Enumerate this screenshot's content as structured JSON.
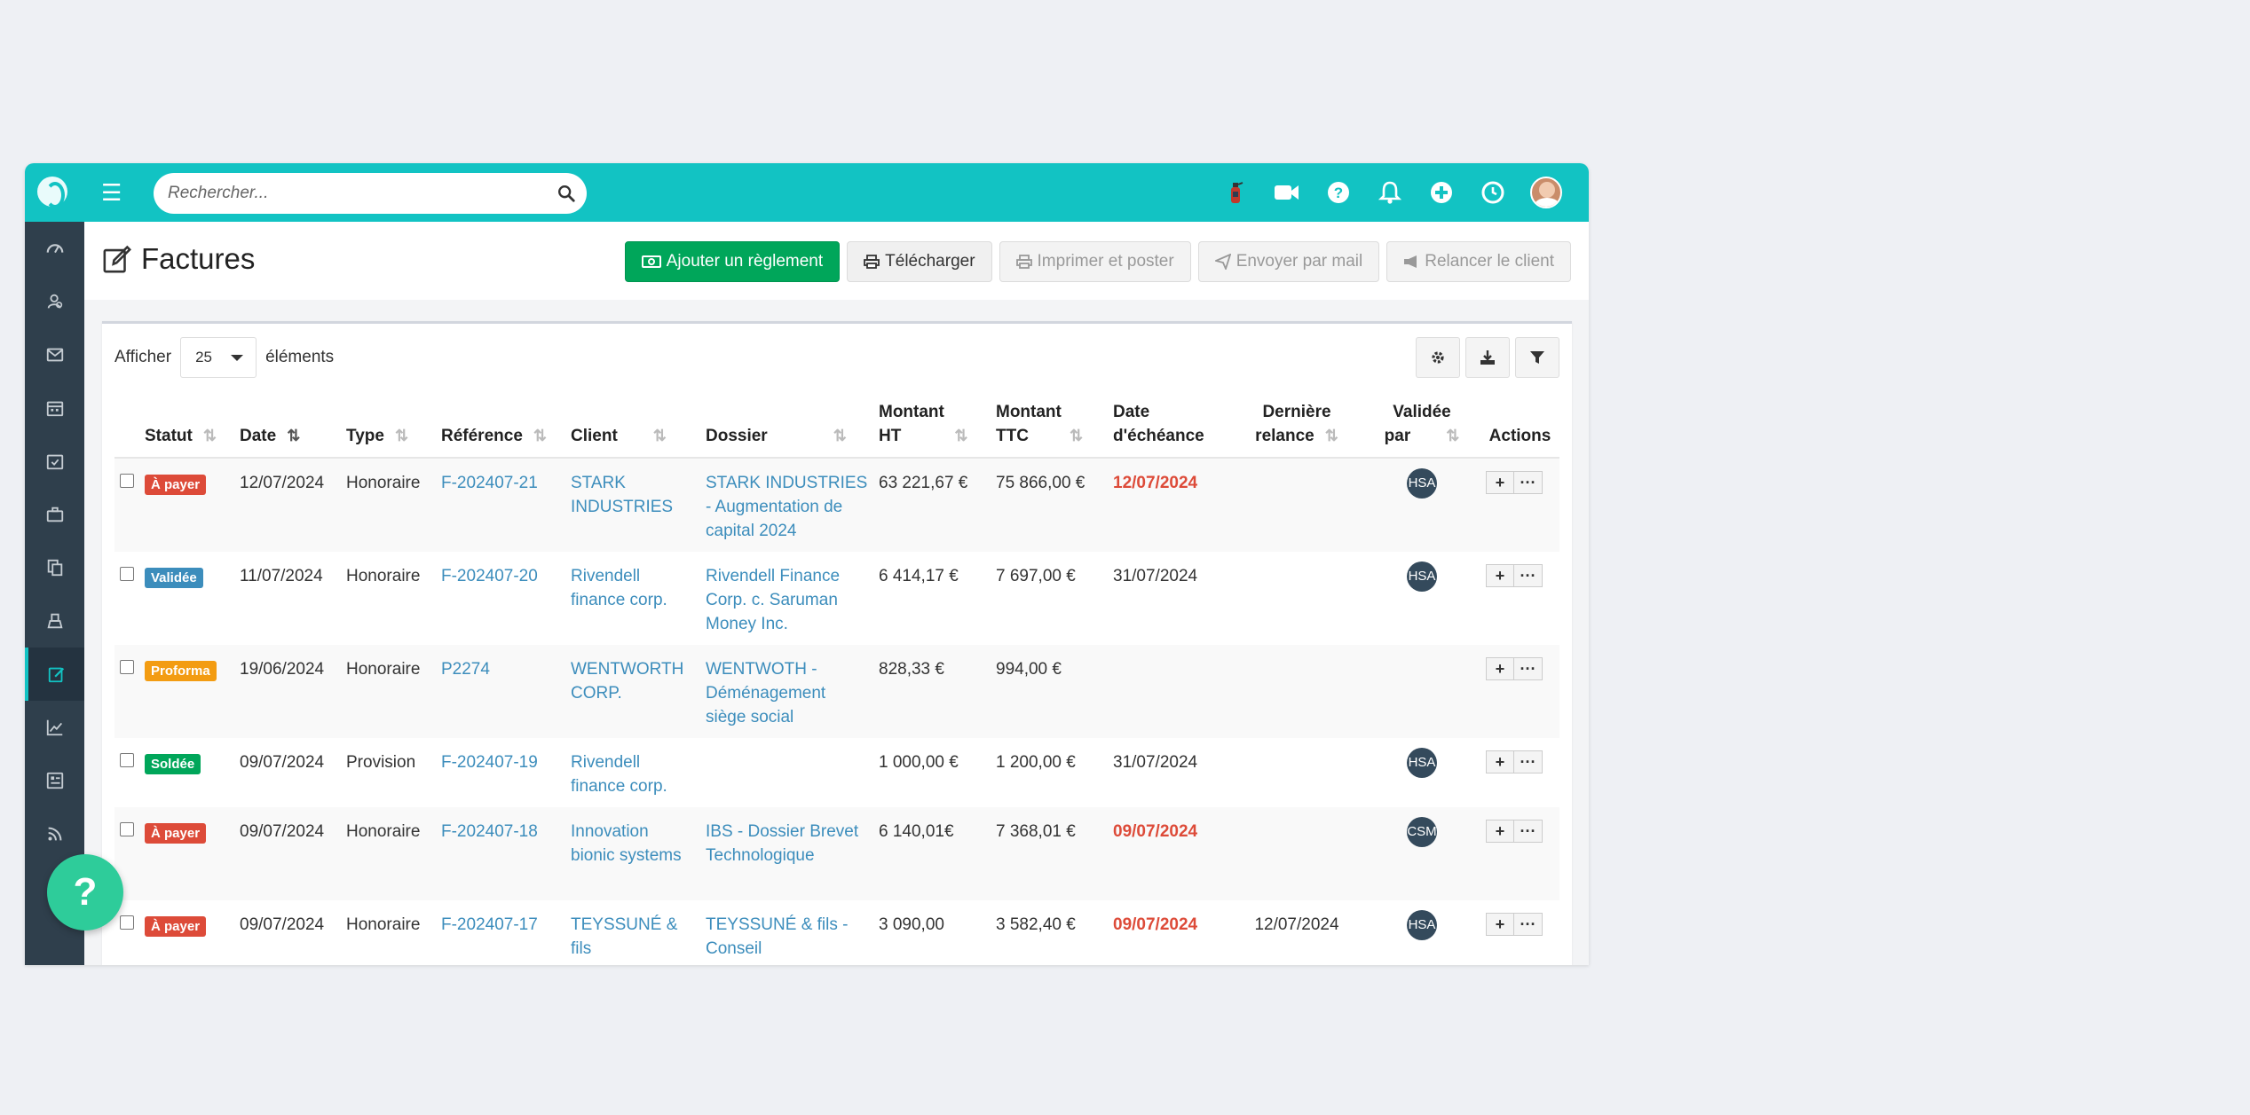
{
  "search": {
    "placeholder": "Rechercher..."
  },
  "page": {
    "title": "Factures"
  },
  "toolbar": {
    "add_payment": "Ajouter un règlement",
    "download": "Télécharger",
    "print_post": "Imprimer et poster",
    "send_mail": "Envoyer par mail",
    "remind_client": "Relancer le client"
  },
  "list": {
    "show_label": "Afficher",
    "page_size": "25",
    "items_label": "éléments"
  },
  "columns": {
    "statut": "Statut",
    "date": "Date",
    "type": "Type",
    "reference": "Référence",
    "client": "Client",
    "dossier": "Dossier",
    "montant_ht_1": "Montant",
    "montant_ht_2": "HT",
    "montant_ttc_1": "Montant",
    "montant_ttc_2": "TTC",
    "echeance_1": "Date",
    "echeance_2": "d'échéance",
    "relance_1": "Dernière",
    "relance_2": "relance",
    "validee_1": "Validée",
    "validee_2": "par",
    "actions": "Actions"
  },
  "rows": [
    {
      "status": "À payer",
      "status_color": "#dd4b39",
      "date": "12/07/2024",
      "type": "Honoraire",
      "reference": "F-202407-21",
      "client": "STARK INDUSTRIES",
      "dossier": "STARK INDUSTRIES - Augmentation de capital 2024",
      "ht": "63 221,67 €",
      "ttc": "75 866,00 €",
      "due": "12/07/2024",
      "due_late": true,
      "relance": "",
      "validated_by": "HSA"
    },
    {
      "status": "Validée",
      "status_color": "#3c8dbc",
      "date": "11/07/2024",
      "type": "Honoraire",
      "reference": "F-202407-20",
      "client": "Rivendell finance corp.",
      "dossier": "Rivendell Finance Corp. c. Saruman Money Inc.",
      "ht": "6 414,17 €",
      "ttc": "7 697,00 €",
      "due": "31/07/2024",
      "due_late": false,
      "relance": "",
      "validated_by": "HSA"
    },
    {
      "status": "Proforma",
      "status_color": "#f39c12",
      "date": "19/06/2024",
      "type": "Honoraire",
      "reference": "P2274",
      "client": "WENTWORTH CORP.",
      "dossier": "WENTWOTH - Déménagement siège social",
      "ht": "828,33 €",
      "ttc": "994,00 €",
      "due": "",
      "due_late": false,
      "relance": "",
      "validated_by": ""
    },
    {
      "status": "Soldée",
      "status_color": "#00a65a",
      "date": "09/07/2024",
      "type": "Provision",
      "reference": "F-202407-19",
      "client": "Rivendell finance corp.",
      "dossier": "",
      "ht": "1 000,00 €",
      "ttc": "1 200,00 €",
      "due": "31/07/2024",
      "due_late": false,
      "relance": "",
      "validated_by": "HSA"
    },
    {
      "status": "À payer",
      "status_color": "#dd4b39",
      "date": "09/07/2024",
      "type": "Honoraire",
      "reference": "F-202407-18",
      "client": "Innovation bionic systems",
      "dossier": "IBS - Dossier Brevet Technologique",
      "ht": "6 140,01€",
      "ttc": "7 368,01 €",
      "due": "09/07/2024",
      "due_late": true,
      "relance": "",
      "validated_by": "CSM"
    },
    {
      "status": "À payer",
      "status_color": "#dd4b39",
      "date": "09/07/2024",
      "type": "Honoraire",
      "reference": "F-202407-17",
      "client": "TEYSSUNÉ & fils",
      "dossier": "TEYSSUNÉ & fils - Conseil",
      "ht": "3 090,00",
      "ttc": "3 582,40 €",
      "due": "09/07/2024",
      "due_late": true,
      "relance": "12/07/2024",
      "validated_by": "HSA"
    }
  ],
  "help": {
    "label": "?"
  },
  "colors": {
    "topbar": "#12c3c3",
    "sidebar": "#2f3f4c",
    "primary": "#00a65a",
    "link": "#3c8dbc",
    "danger": "#dd4b39"
  }
}
